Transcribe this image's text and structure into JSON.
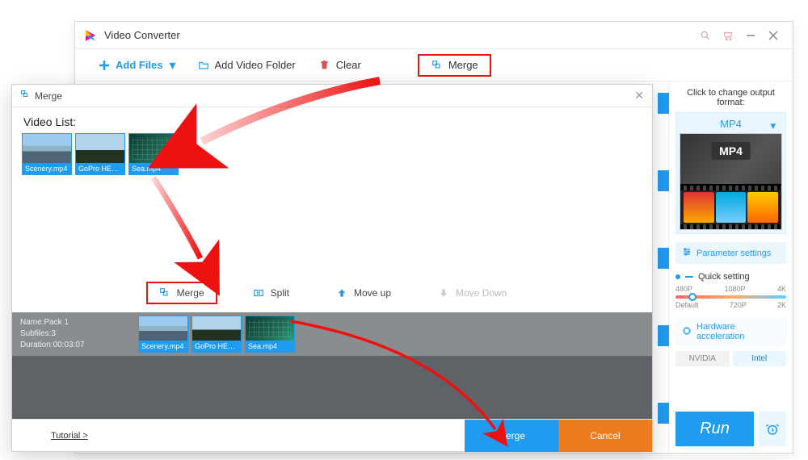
{
  "main": {
    "title": "Video Converter",
    "toolbar": {
      "add_files": "Add Files",
      "add_folder": "Add Video Folder",
      "clear": "Clear",
      "merge": "Merge"
    }
  },
  "side": {
    "header": "Click to change output format:",
    "format_label": "MP4",
    "format_badge": "MP4",
    "param_settings": "Parameter settings",
    "quick_setting": "Quick setting",
    "quality_ticks_top": [
      "480P",
      "1080P",
      "4K"
    ],
    "quality_ticks_bottom": [
      "Default",
      "720P",
      "2K"
    ],
    "hw_accel": "Hardware acceleration",
    "hw_chips": {
      "nvidia": "NVIDIA",
      "intel": "Intel"
    },
    "run": "Run"
  },
  "dialog": {
    "title": "Merge",
    "video_list_label": "Video List:",
    "thumbs": [
      {
        "label": "Scenery.mp4"
      },
      {
        "label": "GoPro HER..."
      },
      {
        "label": "Sea.mp4"
      }
    ],
    "toolbar": {
      "merge": "Merge",
      "split": "Split",
      "move_up": "Move up",
      "move_down": "Move Down"
    },
    "pack": {
      "name_line": "Name:Pack 1",
      "subfiles_line": "Subfiles:3",
      "duration_line": "Duration:00:03:07"
    },
    "tutorial": "Tutorial >",
    "merge_btn": "Merge",
    "cancel_btn": "Cancel"
  }
}
